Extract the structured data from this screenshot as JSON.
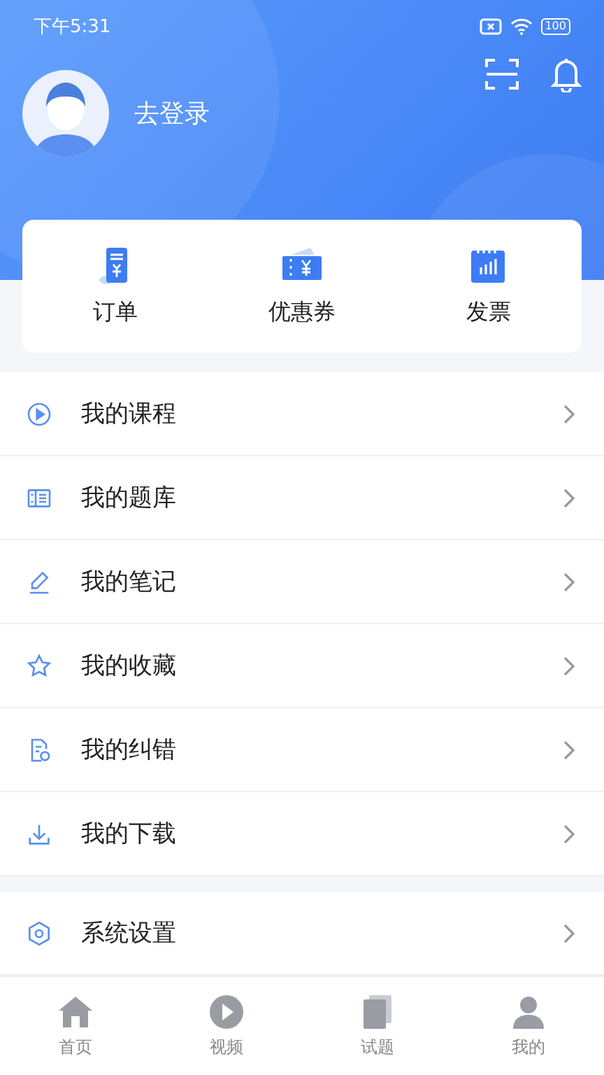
{
  "status_bar": {
    "time": "下午5:31",
    "battery": "100"
  },
  "profile": {
    "login": "去登录"
  },
  "quick_actions": [
    {
      "kind": "order",
      "label": "订单"
    },
    {
      "kind": "coupon",
      "label": "优惠券"
    },
    {
      "kind": "invoice",
      "label": "发票"
    }
  ],
  "menu": [
    {
      "kind": "course",
      "label": "我的课程"
    },
    {
      "kind": "questions",
      "label": "我的题库"
    },
    {
      "kind": "notes",
      "label": "我的笔记"
    },
    {
      "kind": "favorites",
      "label": "我的收藏"
    },
    {
      "kind": "errata",
      "label": "我的纠错"
    },
    {
      "kind": "downloads",
      "label": "我的下载"
    }
  ],
  "settings": [
    {
      "kind": "settings",
      "label": "系统设置"
    }
  ],
  "tab_bar": [
    {
      "kind": "home",
      "label": "首页",
      "selected": false
    },
    {
      "kind": "video",
      "label": "视频",
      "selected": false
    },
    {
      "kind": "exam",
      "label": "试题",
      "selected": false
    },
    {
      "kind": "me",
      "label": "我的",
      "selected": false
    }
  ]
}
